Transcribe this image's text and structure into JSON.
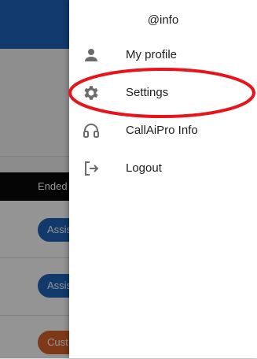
{
  "background": {
    "table_header_label": "Ended",
    "row_pills": [
      {
        "label": "Assis",
        "color": "#1e63b8"
      },
      {
        "label": "Assis",
        "color": "#1e63b8"
      },
      {
        "label": "Cust",
        "color": "#d9622b"
      }
    ]
  },
  "drawer": {
    "username": "@info",
    "items": [
      {
        "label": "My profile",
        "icon": "person-icon"
      },
      {
        "label": "Settings",
        "icon": "gear-icon"
      },
      {
        "label": "CallAiPro Info",
        "icon": "headset-icon"
      },
      {
        "label": "Logout",
        "icon": "logout-icon"
      }
    ]
  },
  "annotation": {
    "highlight_color": "#e8141c",
    "highlighted_item": "Settings"
  },
  "colors": {
    "primary": "#1e63b8",
    "accent_orange": "#d9622b",
    "icon_gray": "#6b6b6b"
  }
}
